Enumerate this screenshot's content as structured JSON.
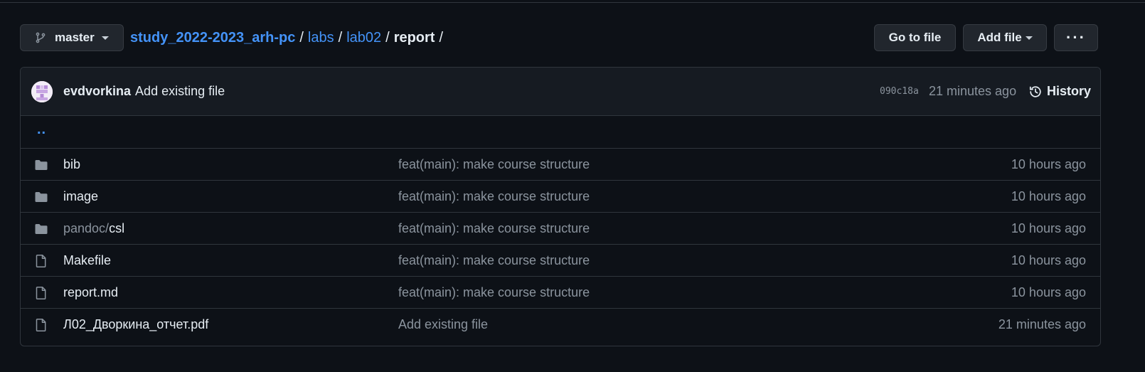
{
  "colors": {
    "background": "#0d1117",
    "link": "#4493f8",
    "muted": "#8b949e",
    "border": "#30363d",
    "button_bg": "#21262d",
    "header_bg": "#161b22"
  },
  "toolbar": {
    "branch": "master",
    "branch_icon": "git-branch-icon",
    "breadcrumb": {
      "root": "study_2022-2023_arh-pc",
      "parts": [
        "labs",
        "lab02"
      ],
      "current": "report",
      "separator": "/"
    },
    "go_to_file": "Go to file",
    "add_file": "Add file",
    "more": "···"
  },
  "commit": {
    "author": "evdvorkina",
    "message": "Add existing file",
    "hash": "090c18a",
    "time": "21 minutes ago",
    "history_label": "History",
    "history_icon": "history-icon"
  },
  "parent_link": "..",
  "files": [
    {
      "type": "directory",
      "icon": "folder-icon",
      "name": "bib",
      "message": "feat(main): make course structure",
      "age": "10 hours ago"
    },
    {
      "type": "directory",
      "icon": "folder-icon",
      "name": "image",
      "message": "feat(main): make course structure",
      "age": "10 hours ago"
    },
    {
      "type": "directory",
      "icon": "folder-icon",
      "name_prefix": "pandoc/",
      "name": "csl",
      "message": "feat(main): make course structure",
      "age": "10 hours ago"
    },
    {
      "type": "file",
      "icon": "file-icon",
      "name": "Makefile",
      "message": "feat(main): make course structure",
      "age": "10 hours ago"
    },
    {
      "type": "file",
      "icon": "file-icon",
      "name": "report.md",
      "message": "feat(main): make course structure",
      "age": "10 hours ago"
    },
    {
      "type": "file",
      "icon": "file-icon",
      "name": "Л02_Дворкина_отчет.pdf",
      "message": "Add existing file",
      "age": "21 minutes ago"
    }
  ]
}
